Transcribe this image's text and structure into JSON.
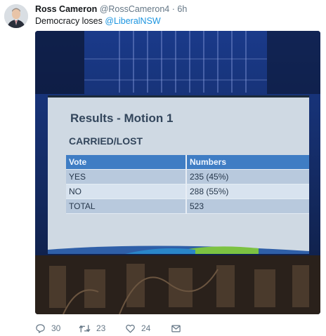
{
  "tweet": {
    "author_name": "Ross Cameron",
    "handle": "@RossCameron4",
    "separator": "·",
    "time": "6h",
    "text": "Democracy loses ",
    "mention": "@LiberalNSW"
  },
  "slide": {
    "title": "Results - Motion 1",
    "subtitle": "CARRIED/LOST",
    "columns": [
      "Vote",
      "Numbers"
    ],
    "rows": [
      [
        "YES",
        "235 (45%)"
      ],
      [
        "NO",
        "288 (55%)"
      ],
      [
        "TOTAL",
        "523"
      ]
    ]
  },
  "actions": {
    "reply_count": "30",
    "retweet_count": "23",
    "like_count": "24"
  },
  "icons": {
    "reply": "reply-icon",
    "retweet": "retweet-icon",
    "like": "heart-icon",
    "dm": "envelope-icon"
  },
  "colors": {
    "accent": "#1b95e0",
    "muted": "#657786",
    "table_header": "#3f7dc4"
  }
}
